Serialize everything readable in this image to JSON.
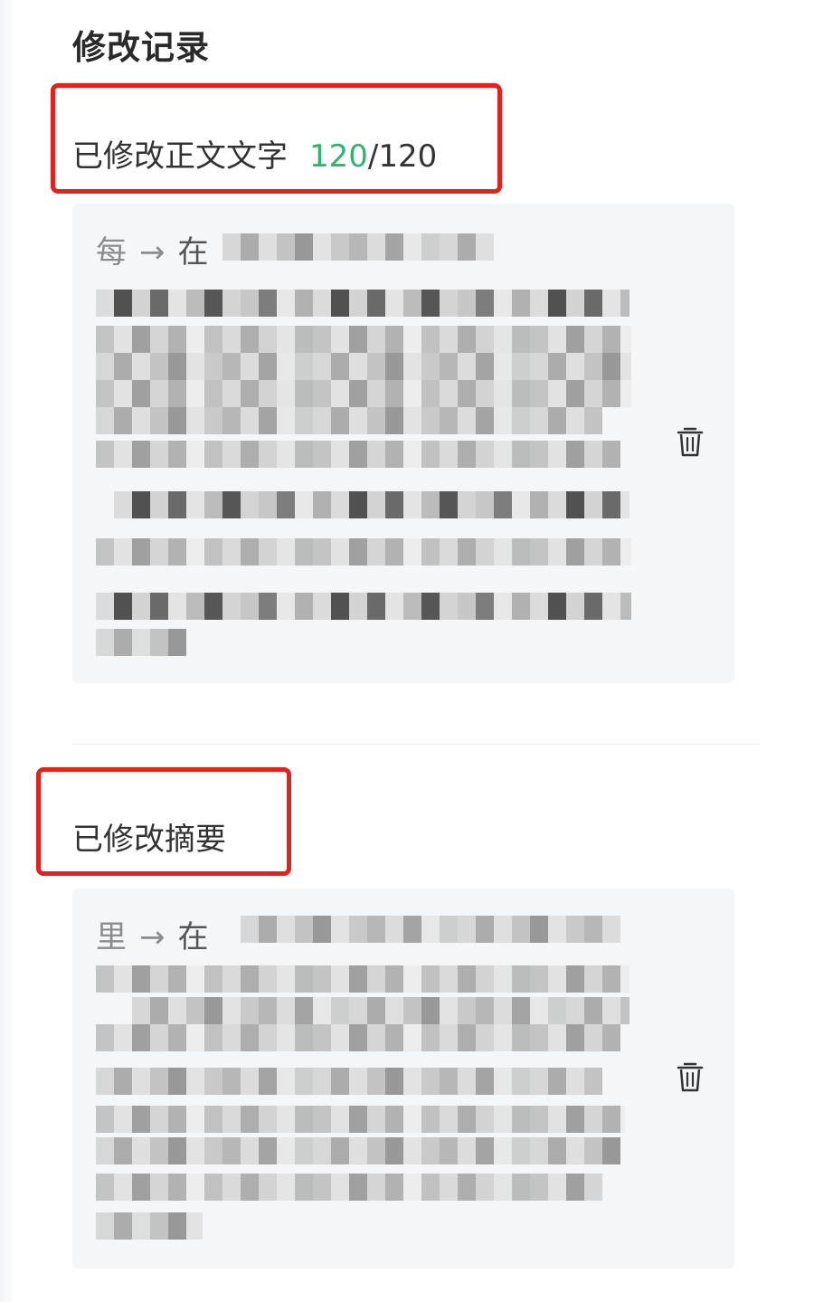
{
  "panel": {
    "title": "修改记录"
  },
  "records": [
    {
      "label": "已修改正文文字",
      "count_current": "120",
      "count_separator": "/",
      "count_total": "120",
      "original_word": "每",
      "arrow": "→",
      "replacement_word": "在",
      "delete_icon": "trash-icon"
    },
    {
      "label": "已修改摘要",
      "original_word": "里",
      "arrow": "→",
      "replacement_word": "在",
      "delete_icon": "trash-icon"
    }
  ],
  "colors": {
    "highlight_border": "#e3221c",
    "count_accent": "#2fb66c",
    "card_background": "#f5f6f8"
  }
}
